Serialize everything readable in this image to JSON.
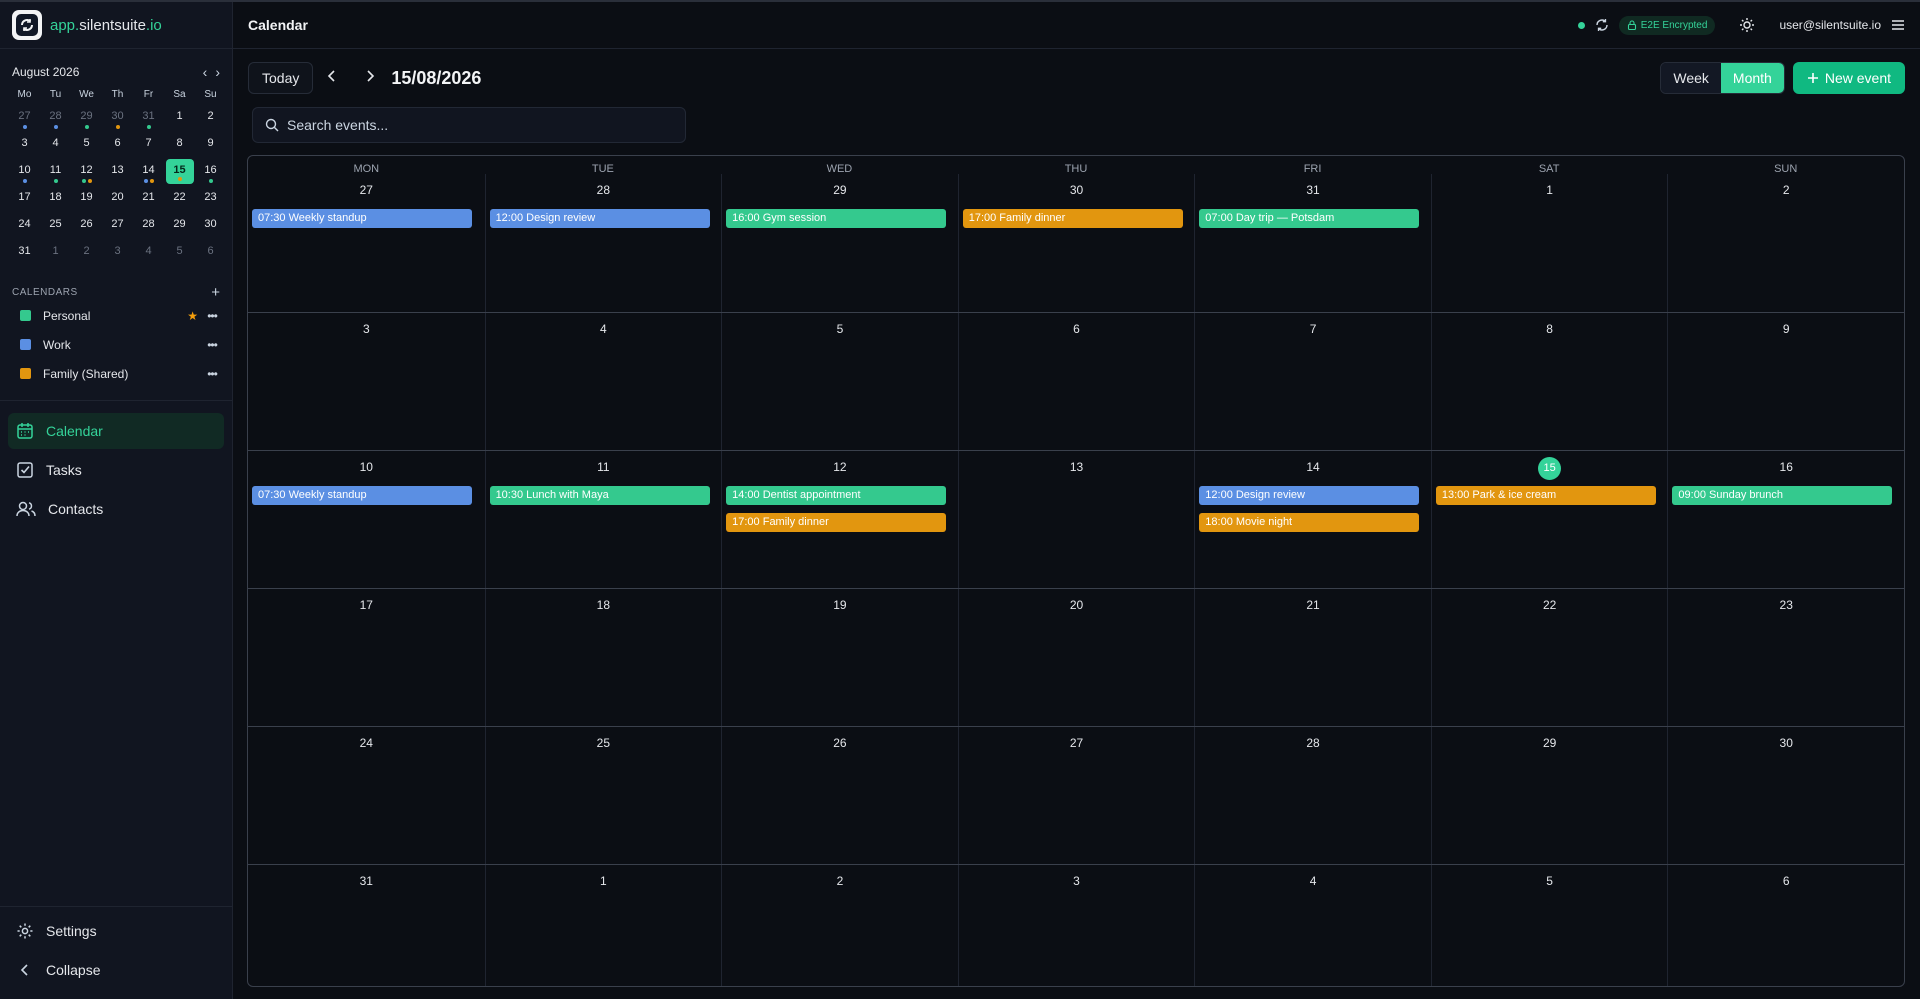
{
  "brand": {
    "prefix": "app.",
    "name": "silentsuite",
    "suffix": ".io"
  },
  "colors": {
    "personal": "#34c98e",
    "work": "#5b8fe3",
    "family": "#e2960f",
    "accent": "#34d399"
  },
  "mini_calendar": {
    "title": "August 2026",
    "prev_icon": "chevron-left-icon",
    "next_icon": "chevron-right-icon",
    "dow": [
      "Mo",
      "Tu",
      "We",
      "Th",
      "Fr",
      "Sa",
      "Su"
    ],
    "days": [
      {
        "n": "27",
        "m": true,
        "d": [
          "work"
        ]
      },
      {
        "n": "28",
        "m": true,
        "d": [
          "work"
        ]
      },
      {
        "n": "29",
        "m": true,
        "d": [
          "personal"
        ]
      },
      {
        "n": "30",
        "m": true,
        "d": [
          "family"
        ]
      },
      {
        "n": "31",
        "m": true,
        "d": [
          "personal"
        ]
      },
      {
        "n": "1"
      },
      {
        "n": "2"
      },
      {
        "n": "3"
      },
      {
        "n": "4"
      },
      {
        "n": "5"
      },
      {
        "n": "6"
      },
      {
        "n": "7"
      },
      {
        "n": "8"
      },
      {
        "n": "9"
      },
      {
        "n": "10",
        "d": [
          "work"
        ]
      },
      {
        "n": "11",
        "d": [
          "personal"
        ]
      },
      {
        "n": "12",
        "d": [
          "personal",
          "family"
        ]
      },
      {
        "n": "13"
      },
      {
        "n": "14",
        "d": [
          "work",
          "family"
        ]
      },
      {
        "n": "15",
        "today": true,
        "d": [
          "family"
        ]
      },
      {
        "n": "16",
        "d": [
          "personal"
        ]
      },
      {
        "n": "17"
      },
      {
        "n": "18"
      },
      {
        "n": "19"
      },
      {
        "n": "20"
      },
      {
        "n": "21"
      },
      {
        "n": "22"
      },
      {
        "n": "23"
      },
      {
        "n": "24"
      },
      {
        "n": "25"
      },
      {
        "n": "26"
      },
      {
        "n": "27"
      },
      {
        "n": "28"
      },
      {
        "n": "29"
      },
      {
        "n": "30"
      },
      {
        "n": "31"
      },
      {
        "n": "1",
        "m": true
      },
      {
        "n": "2",
        "m": true
      },
      {
        "n": "3",
        "m": true
      },
      {
        "n": "4",
        "m": true
      },
      {
        "n": "5",
        "m": true
      },
      {
        "n": "6",
        "m": true
      }
    ]
  },
  "calendars": {
    "heading": "CALENDARS",
    "add_label": "+",
    "items": [
      {
        "name": "Personal",
        "color": "#34c98e",
        "starred": true
      },
      {
        "name": "Work",
        "color": "#5b8fe3",
        "starred": false
      },
      {
        "name": "Family (Shared)",
        "color": "#e2960f",
        "starred": false
      }
    ]
  },
  "nav": {
    "calendar": "Calendar",
    "tasks": "Tasks",
    "contacts": "Contacts",
    "settings": "Settings",
    "collapse": "Collapse"
  },
  "topbar": {
    "title": "Calendar",
    "e2e_label": "E2E Encrypted",
    "user": "user@silentsuite.io"
  },
  "toolbar": {
    "today": "Today",
    "date": "15/08/2026",
    "week": "Week",
    "month": "Month",
    "new_event": "New event"
  },
  "search": {
    "placeholder": "Search events..."
  },
  "month": {
    "dow": [
      "MON",
      "TUE",
      "WED",
      "THU",
      "FRI",
      "SAT",
      "SUN"
    ],
    "selected_day": "15",
    "weeks": [
      [
        {
          "n": "27",
          "events": [
            {
              "t": "07:30 Weekly standup",
              "c": "work"
            }
          ]
        },
        {
          "n": "28",
          "events": [
            {
              "t": "12:00 Design review",
              "c": "work"
            }
          ]
        },
        {
          "n": "29",
          "events": [
            {
              "t": "16:00 Gym session",
              "c": "personal"
            }
          ]
        },
        {
          "n": "30",
          "events": [
            {
              "t": "17:00 Family dinner",
              "c": "family"
            }
          ]
        },
        {
          "n": "31",
          "events": [
            {
              "t": "07:00 Day trip — Potsdam",
              "c": "personal"
            }
          ]
        },
        {
          "n": "1",
          "events": []
        },
        {
          "n": "2",
          "events": []
        }
      ],
      [
        {
          "n": "3",
          "events": []
        },
        {
          "n": "4",
          "events": []
        },
        {
          "n": "5",
          "events": []
        },
        {
          "n": "6",
          "events": []
        },
        {
          "n": "7",
          "events": []
        },
        {
          "n": "8",
          "events": []
        },
        {
          "n": "9",
          "events": []
        }
      ],
      [
        {
          "n": "10",
          "events": [
            {
              "t": "07:30 Weekly standup",
              "c": "work"
            }
          ]
        },
        {
          "n": "11",
          "events": [
            {
              "t": "10:30 Lunch with Maya",
              "c": "personal"
            }
          ]
        },
        {
          "n": "12",
          "events": [
            {
              "t": "14:00 Dentist appointment",
              "c": "personal"
            },
            {
              "t": "17:00 Family dinner",
              "c": "family"
            }
          ]
        },
        {
          "n": "13",
          "events": []
        },
        {
          "n": "14",
          "events": [
            {
              "t": "12:00 Design review",
              "c": "work"
            },
            {
              "t": "18:00 Movie night",
              "c": "family"
            }
          ]
        },
        {
          "n": "15",
          "sel": true,
          "events": [
            {
              "t": "13:00 Park & ice cream",
              "c": "family"
            }
          ]
        },
        {
          "n": "16",
          "events": [
            {
              "t": "09:00 Sunday brunch",
              "c": "personal"
            }
          ]
        }
      ],
      [
        {
          "n": "17",
          "events": []
        },
        {
          "n": "18",
          "events": []
        },
        {
          "n": "19",
          "events": []
        },
        {
          "n": "20",
          "events": []
        },
        {
          "n": "21",
          "events": []
        },
        {
          "n": "22",
          "events": []
        },
        {
          "n": "23",
          "events": []
        }
      ],
      [
        {
          "n": "24",
          "events": []
        },
        {
          "n": "25",
          "events": []
        },
        {
          "n": "26",
          "events": []
        },
        {
          "n": "27",
          "events": []
        },
        {
          "n": "28",
          "events": []
        },
        {
          "n": "29",
          "events": []
        },
        {
          "n": "30",
          "events": []
        }
      ],
      [
        {
          "n": "31",
          "events": []
        },
        {
          "n": "1",
          "events": []
        },
        {
          "n": "2",
          "events": []
        },
        {
          "n": "3",
          "events": []
        },
        {
          "n": "4",
          "events": []
        },
        {
          "n": "5",
          "events": []
        },
        {
          "n": "6",
          "events": []
        }
      ]
    ]
  }
}
